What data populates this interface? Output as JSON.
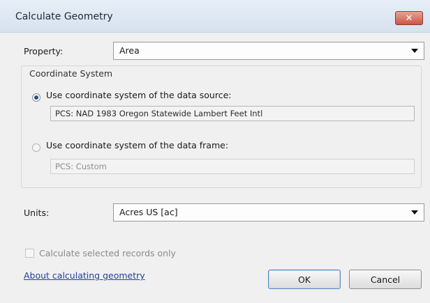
{
  "window": {
    "title": "Calculate Geometry",
    "close_label": "✕"
  },
  "property": {
    "label": "Property:",
    "selected": "Area"
  },
  "coordinate_system": {
    "title": "Coordinate System",
    "option_source": {
      "label": "Use coordinate system of the data source:",
      "value": "PCS: NAD 1983 Oregon Statewide Lambert Feet Intl",
      "selected": true
    },
    "option_frame": {
      "label": "Use coordinate system of the data frame:",
      "value": "PCS: Custom",
      "selected": false
    }
  },
  "units": {
    "label": "Units:",
    "selected": "Acres US [ac]"
  },
  "selected_only": {
    "label": "Calculate selected records only",
    "checked": false,
    "enabled": false
  },
  "help_link": "About calculating geometry",
  "buttons": {
    "ok": "OK",
    "cancel": "Cancel"
  },
  "colors": {
    "link": "#1f3f9a",
    "close_button": "#c75846",
    "title_bar": "#dde6f1"
  }
}
